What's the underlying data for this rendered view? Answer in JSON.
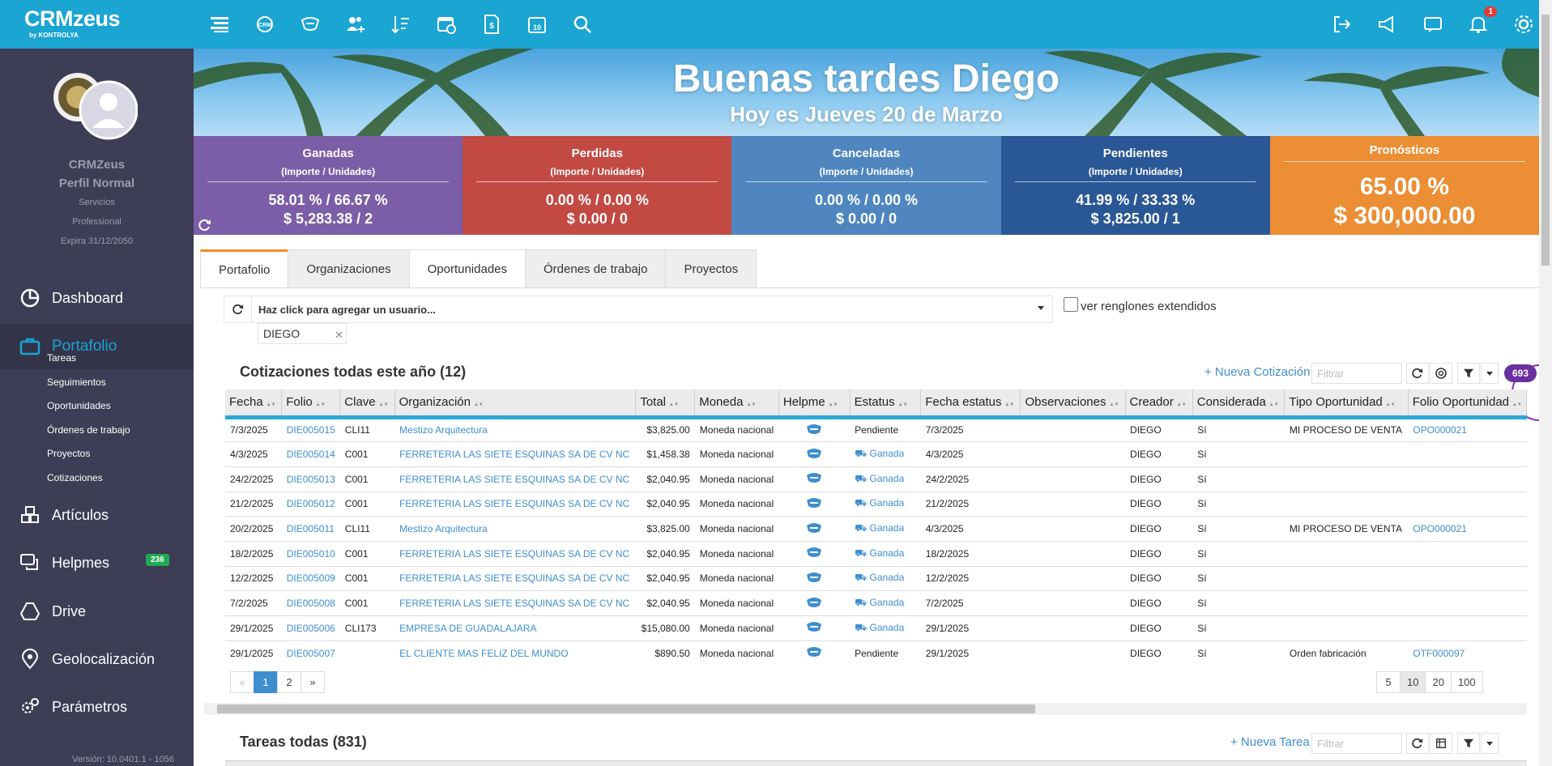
{
  "brand": {
    "name": "CRMzeus",
    "by": "by KONTROLYA"
  },
  "topbar": {
    "left_icons": [
      "menu-icon",
      "crm-icon",
      "helpme-icon",
      "users-add-icon",
      "sort-icon",
      "calendar-clock-icon",
      "invoice-icon",
      "calendar-10-icon",
      "search-icon"
    ],
    "right_icons": [
      "logout-icon",
      "megaphone-icon",
      "chat-icon",
      "bell-icon",
      "settings-icon"
    ],
    "notification_count": "1"
  },
  "sidebar": {
    "user_name": "CRMZeus",
    "profile": "Perfil Normal",
    "plan_line1": "Servicios",
    "plan_line2": "Professional",
    "expires": "Expira 31/12/2050",
    "nav": [
      {
        "label": "Dashboard",
        "icon": "pie-chart-icon"
      },
      {
        "label": "Portafolio",
        "icon": "briefcase-icon"
      },
      {
        "label": "Artículos",
        "icon": "boxes-icon"
      },
      {
        "label": "Helpmes",
        "icon": "chat-bubbles-icon",
        "badge": "236"
      },
      {
        "label": "Drive",
        "icon": "drive-icon"
      },
      {
        "label": "Geolocalización",
        "icon": "map-pin-icon"
      },
      {
        "label": "Parámetros",
        "icon": "gears-icon"
      }
    ],
    "subitems": [
      "Tareas",
      "Seguimientos",
      "Oportunidades",
      "Órdenes de trabajo",
      "Proyectos",
      "Cotizaciones"
    ],
    "version": "Versión: 10.0401.1 - 1056"
  },
  "hero": {
    "greeting": "Buenas tardes Diego",
    "date": "Hoy es Jueves 20 de Marzo"
  },
  "stats": [
    {
      "title": "Ganadas",
      "sub": "(Importe / Unidades)",
      "v1": "58.01 % / 66.67 %",
      "v2": "$ 5,283.38 / 2",
      "color": "#7b5ea7"
    },
    {
      "title": "Perdidas",
      "sub": "(Importe / Unidades)",
      "v1": "0.00 % / 0.00 %",
      "v2": "$ 0.00 / 0",
      "color": "#c24a43"
    },
    {
      "title": "Canceladas",
      "sub": "(Importe / Unidades)",
      "v1": "0.00 % / 0.00 %",
      "v2": "$ 0.00 / 0",
      "color": "#4f86c0"
    },
    {
      "title": "Pendientes",
      "sub": "(Importe / Unidades)",
      "v1": "41.99 % / 33.33 %",
      "v2": "$ 3,825.00 / 1",
      "color": "#2a5796"
    },
    {
      "title": "Pronósticos",
      "v1": "65.00 %",
      "v2": "$ 300,000.00",
      "color": "#eb8e34"
    }
  ],
  "tabs": [
    "Portafolio",
    "Organizaciones",
    "Oportunidades",
    "Órdenes de trabajo",
    "Proyectos"
  ],
  "user_filter": {
    "placeholder": "Haz click para agregar un usuario...",
    "tag": "DIEGO",
    "extended_label": "ver renglones extendidos"
  },
  "quotes": {
    "title": "Cotizaciones todas este año (12)",
    "new_label": "+ Nueva Cotización",
    "filter_placeholder": "Filtrar",
    "count_badge": "693",
    "columns": [
      "Fecha",
      "Folio",
      "Clave",
      "Organización",
      "Total",
      "Moneda",
      "Helpme",
      "Estatus",
      "Fecha estatus",
      "Observaciones",
      "Creador",
      "Considerada",
      "Tipo Oportunidad",
      "Folio Oportunidad"
    ],
    "rows": [
      [
        "7/3/2025",
        "DIE005015",
        "CLI11",
        "Mestizo Arquitectura",
        "$3,825.00",
        "Moneda nacional",
        "",
        "Pendiente",
        "7/3/2025",
        "",
        "DIEGO",
        "Sí",
        "MI PROCESO DE VENTA",
        "OPO000021"
      ],
      [
        "4/3/2025",
        "DIE005014",
        "C001",
        "FERRETERIA LAS SIETE ESQUINAS SA DE CV NC",
        "$1,458.38",
        "Moneda nacional",
        "",
        "Ganada",
        "4/3/2025",
        "",
        "DIEGO",
        "Sí",
        "",
        ""
      ],
      [
        "24/2/2025",
        "DIE005013",
        "C001",
        "FERRETERIA LAS SIETE ESQUINAS SA DE CV NC",
        "$2,040.95",
        "Moneda nacional",
        "",
        "Ganada",
        "24/2/2025",
        "",
        "DIEGO",
        "Sí",
        "",
        ""
      ],
      [
        "21/2/2025",
        "DIE005012",
        "C001",
        "FERRETERIA LAS SIETE ESQUINAS SA DE CV NC",
        "$2,040.95",
        "Moneda nacional",
        "",
        "Ganada",
        "21/2/2025",
        "",
        "DIEGO",
        "Sí",
        "",
        ""
      ],
      [
        "20/2/2025",
        "DIE005011",
        "CLI11",
        "Mestizo Arquitectura",
        "$3,825.00",
        "Moneda nacional",
        "",
        "Ganada",
        "4/3/2025",
        "",
        "DIEGO",
        "Sí",
        "MI PROCESO DE VENTA",
        "OPO000021"
      ],
      [
        "18/2/2025",
        "DIE005010",
        "C001",
        "FERRETERIA LAS SIETE ESQUINAS SA DE CV NC",
        "$2,040.95",
        "Moneda nacional",
        "",
        "Ganada",
        "18/2/2025",
        "",
        "DIEGO",
        "Sí",
        "",
        ""
      ],
      [
        "12/2/2025",
        "DIE005009",
        "C001",
        "FERRETERIA LAS SIETE ESQUINAS SA DE CV NC",
        "$2,040.95",
        "Moneda nacional",
        "",
        "Ganada",
        "12/2/2025",
        "",
        "DIEGO",
        "Sí",
        "",
        ""
      ],
      [
        "7/2/2025",
        "DIE005008",
        "C001",
        "FERRETERIA LAS SIETE ESQUINAS SA DE CV NC",
        "$2,040.95",
        "Moneda nacional",
        "",
        "Ganada",
        "7/2/2025",
        "",
        "DIEGO",
        "Sí",
        "",
        ""
      ],
      [
        "29/1/2025",
        "DIE005006",
        "CLI173",
        "EMPRESA DE GUADALAJARA",
        "$15,080.00",
        "Moneda nacional",
        "",
        "Ganada",
        "29/1/2025",
        "",
        "DIEGO",
        "Sí",
        "",
        ""
      ],
      [
        "29/1/2025",
        "DIE005007",
        "",
        "EL CLIENTE MAS FELIZ DEL MUNDO",
        "$890.50",
        "Moneda nacional",
        "",
        "Pendiente",
        "29/1/2025",
        "",
        "DIEGO",
        "Sí",
        "Orden fabricación",
        "OTF000097"
      ]
    ],
    "pager": [
      "«",
      "1",
      "2",
      "»"
    ],
    "page_sizes": [
      "5",
      "10",
      "20",
      "100"
    ]
  },
  "tasks": {
    "title": "Tareas todas (831)",
    "new_label": "+ Nueva Tarea",
    "filter_placeholder": "Filtrar"
  }
}
